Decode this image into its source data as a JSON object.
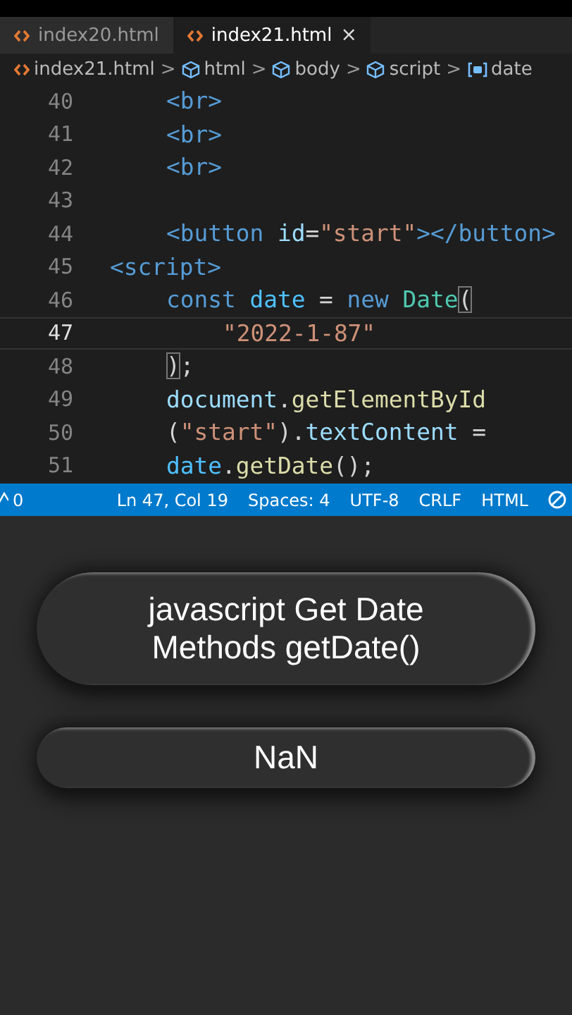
{
  "tabs": [
    {
      "label": "index20.html",
      "selected": false
    },
    {
      "label": "index21.html",
      "selected": true,
      "close": "×"
    }
  ],
  "breadcrumb": [
    {
      "label": "index21.html",
      "kind": "file"
    },
    {
      "label": "html",
      "kind": "element"
    },
    {
      "label": "body",
      "kind": "element"
    },
    {
      "label": "script",
      "kind": "element"
    },
    {
      "label": "date",
      "kind": "variable"
    }
  ],
  "breadcrumb_separator": ">",
  "editor": {
    "lines": [
      {
        "number": "40",
        "current": false,
        "kind": "inner",
        "tokens": [
          {
            "text": "<br>",
            "kind": "tag"
          }
        ]
      },
      {
        "number": "41",
        "current": false,
        "kind": "inner",
        "tokens": [
          {
            "text": "<br>",
            "kind": "tag"
          }
        ]
      },
      {
        "number": "42",
        "current": false,
        "kind": "inner",
        "tokens": [
          {
            "text": "<br>",
            "kind": "tag"
          }
        ]
      },
      {
        "number": "43",
        "current": false,
        "kind": "blank"
      },
      {
        "number": "44",
        "current": false,
        "kind": "inner",
        "tokens": [
          {
            "text": "<button",
            "kind": "tag"
          },
          {
            "text": " id",
            "kind": "attr"
          },
          {
            "text": "=",
            "kind": "plain"
          },
          {
            "text": "\"start\"",
            "kind": "string"
          },
          {
            "text": "></button>",
            "kind": "tag"
          }
        ]
      },
      {
        "number": "45",
        "current": false,
        "kind": "outer",
        "tokens": [
          {
            "text": "<script>",
            "kind": "tag"
          }
        ]
      },
      {
        "number": "46",
        "current": false,
        "kind": "inner",
        "tokens": [
          {
            "text": "const",
            "kind": "keyword"
          },
          {
            "text": " date",
            "kind": "variable"
          },
          {
            "text": " = ",
            "kind": "plain"
          },
          {
            "text": "new",
            "kind": "keyword"
          },
          {
            "text": " Date",
            "kind": "class"
          },
          {
            "text": "(",
            "kind": "bracket"
          }
        ]
      },
      {
        "number": "47",
        "current": true,
        "kind": "deeper",
        "tokens": [
          {
            "text": "\"2022-1-87\"",
            "kind": "string"
          }
        ]
      },
      {
        "number": "48",
        "current": false,
        "kind": "inner",
        "tokens": [
          {
            "text": ")",
            "kind": "bracket"
          },
          {
            "text": ";",
            "kind": "plain"
          }
        ]
      },
      {
        "number": "49",
        "current": false,
        "kind": "inner",
        "tokens": [
          {
            "text": "document",
            "kind": "attr"
          },
          {
            "text": ".",
            "kind": "plain"
          },
          {
            "text": "getElementById",
            "kind": "function"
          }
        ]
      },
      {
        "number": "50",
        "current": false,
        "kind": "inner",
        "tokens": [
          {
            "text": "(",
            "kind": "plain"
          },
          {
            "text": "\"start\"",
            "kind": "string"
          },
          {
            "text": ").",
            "kind": "plain"
          },
          {
            "text": "textContent",
            "kind": "attr"
          },
          {
            "text": " =",
            "kind": "plain"
          }
        ]
      },
      {
        "number": "51",
        "current": false,
        "kind": "inner",
        "tokens": [
          {
            "text": "date",
            "kind": "variable"
          },
          {
            "text": ".",
            "kind": "plain"
          },
          {
            "text": "getDate",
            "kind": "function"
          },
          {
            "text": "();",
            "kind": "plain"
          }
        ]
      }
    ]
  },
  "status_bar": {
    "warnings": "0",
    "items": [
      "Ln 47, Col 19",
      "Spaces: 4",
      "UTF-8",
      "CRLF",
      "HTML"
    ]
  },
  "preview": {
    "buttons": [
      {
        "label": "javascript Get Date Methods getDate()"
      },
      {
        "label": "NaN"
      }
    ]
  }
}
